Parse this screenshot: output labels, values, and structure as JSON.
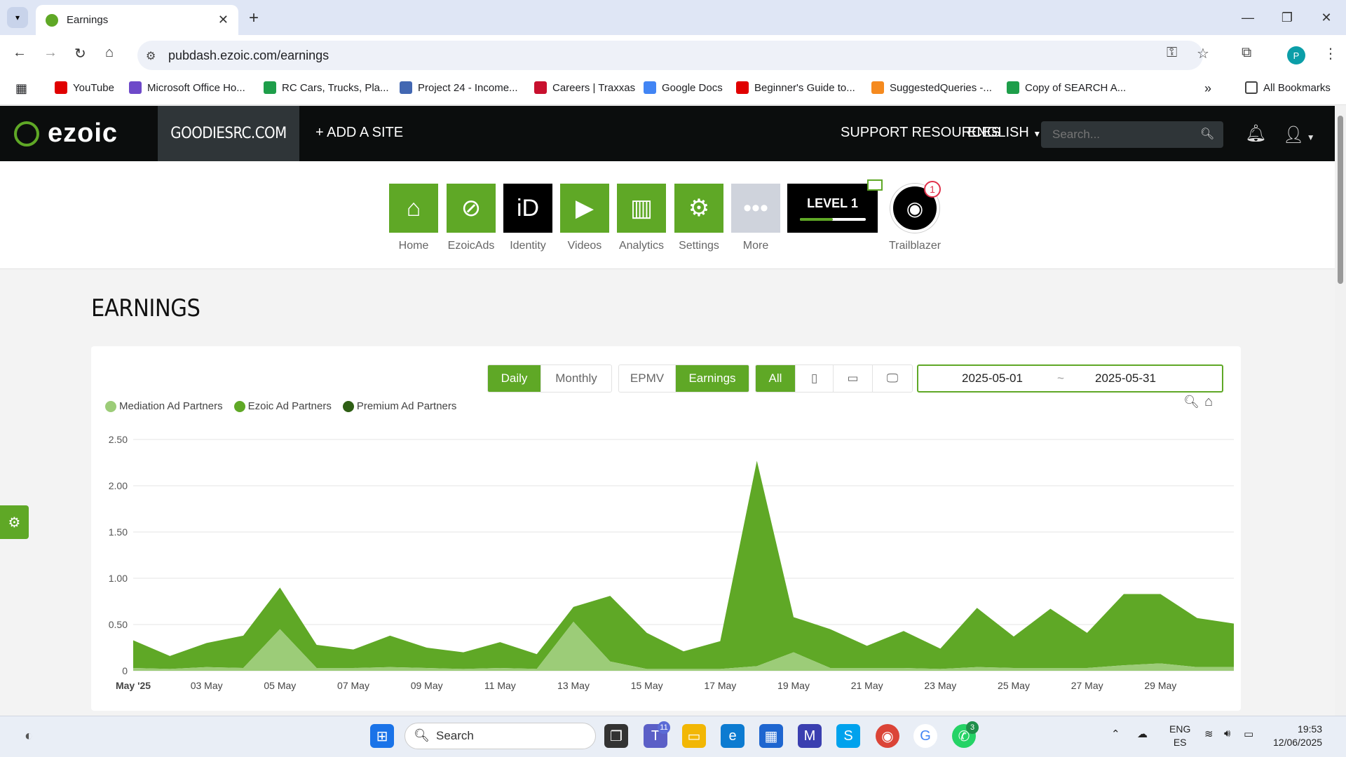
{
  "browser": {
    "tab_title": "Earnings",
    "url": "pubdash.ezoic.com/earnings",
    "profile_initial": "P",
    "bookmarks": [
      {
        "label": "YouTube",
        "color": "#e00000"
      },
      {
        "label": "Microsoft Office Ho...",
        "color": "#6e49c9"
      },
      {
        "label": "RC Cars, Trucks, Pla...",
        "color": "#1e9e4a"
      },
      {
        "label": "Project 24 - Income...",
        "color": "#4267b2"
      },
      {
        "label": "Careers | Traxxas",
        "color": "#c8102e"
      },
      {
        "label": "Google Docs",
        "color": "#4285f4"
      },
      {
        "label": "Beginner's Guide to...",
        "color": "#e00000"
      },
      {
        "label": "SuggestedQueries -...",
        "color": "#f58a1f"
      },
      {
        "label": "Copy of SEARCH A...",
        "color": "#1e9e4a"
      }
    ],
    "all_bookmarks": "All Bookmarks"
  },
  "header": {
    "logo": "ezoic",
    "site": "GOODIESRC.COM",
    "add_site": "+ ADD A SITE",
    "support": "SUPPORT RESOURCES",
    "language": "ENGLISH",
    "search_placeholder": "Search..."
  },
  "apps": [
    {
      "label": "Home",
      "icon": "home-icon"
    },
    {
      "label": "EzoicAds",
      "icon": "ezoic-ads-icon"
    },
    {
      "label": "Identity",
      "icon": "identity-icon"
    },
    {
      "label": "Videos",
      "icon": "videos-icon"
    },
    {
      "label": "Analytics",
      "icon": "analytics-icon"
    },
    {
      "label": "Settings",
      "icon": "settings-icon"
    },
    {
      "label": "More",
      "icon": "more-icon"
    }
  ],
  "level": {
    "label": "LEVEL 1",
    "progress": 0.5
  },
  "trailblazer": {
    "label": "Trailblazer",
    "badge": "1"
  },
  "page_title": "EARNINGS",
  "controls": {
    "daily": "Daily",
    "monthly": "Monthly",
    "epmv": "EPMV",
    "earnings": "Earnings",
    "all": "All",
    "date_from": "2025-05-01",
    "date_sep": "~",
    "date_to": "2025-05-31"
  },
  "colors": {
    "accent": "#5fa826",
    "mediation": "#9ccc78",
    "ezoic": "#5fa826",
    "premium": "#2e5e14"
  },
  "chart_data": {
    "type": "area",
    "stacked": true,
    "x": [
      "May '25",
      "02 May",
      "03 May",
      "04 May",
      "05 May",
      "06 May",
      "07 May",
      "08 May",
      "09 May",
      "10 May",
      "11 May",
      "12 May",
      "13 May",
      "14 May",
      "15 May",
      "16 May",
      "17 May",
      "18 May",
      "19 May",
      "20 May",
      "21 May",
      "22 May",
      "23 May",
      "24 May",
      "25 May",
      "26 May",
      "27 May",
      "28 May",
      "29 May",
      "30 May",
      "31 May"
    ],
    "x_tick_labels": [
      "May '25",
      "03 May",
      "05 May",
      "07 May",
      "09 May",
      "11 May",
      "13 May",
      "15 May",
      "17 May",
      "19 May",
      "21 May",
      "23 May",
      "25 May",
      "27 May",
      "29 May"
    ],
    "y_ticks": [
      "0",
      "0.50",
      "1.00",
      "1.50",
      "2.00",
      "2.50"
    ],
    "ylim": [
      0,
      2.5
    ],
    "series": [
      {
        "name": "Mediation Ad Partners",
        "values": [
          0.03,
          0.02,
          0.04,
          0.03,
          0.45,
          0.03,
          0.03,
          0.04,
          0.03,
          0.02,
          0.03,
          0.02,
          0.53,
          0.1,
          0.02,
          0.02,
          0.02,
          0.05,
          0.2,
          0.03,
          0.03,
          0.03,
          0.02,
          0.04,
          0.03,
          0.03,
          0.03,
          0.06,
          0.08,
          0.04,
          0.04
        ]
      },
      {
        "name": "Ezoic Ad Partners",
        "values": [
          0.3,
          0.14,
          0.26,
          0.35,
          0.45,
          0.25,
          0.2,
          0.34,
          0.22,
          0.18,
          0.28,
          0.16,
          0.16,
          0.71,
          0.39,
          0.19,
          0.3,
          2.22,
          0.38,
          0.42,
          0.24,
          0.4,
          0.22,
          0.64,
          0.34,
          0.64,
          0.38,
          0.77,
          0.75,
          0.53,
          0.47
        ]
      },
      {
        "name": "Premium Ad Partners",
        "values": [
          0,
          0,
          0,
          0,
          0,
          0,
          0,
          0,
          0,
          0,
          0,
          0,
          0,
          0,
          0,
          0,
          0,
          0,
          0,
          0,
          0,
          0,
          0,
          0,
          0,
          0,
          0,
          0,
          0,
          0,
          0
        ]
      }
    ]
  },
  "taskbar": {
    "search": "Search",
    "teams_badge": "11",
    "whatsapp_badge": "3",
    "lang_top": "ENG",
    "lang_bottom": "ES",
    "time": "19:53",
    "date": "12/06/2025"
  }
}
